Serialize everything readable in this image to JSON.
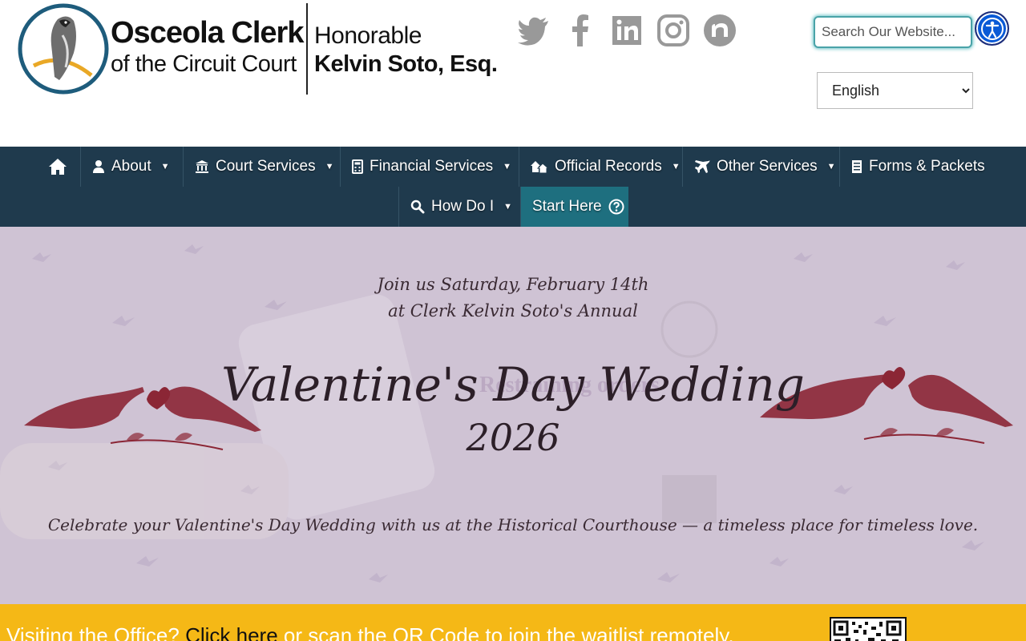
{
  "header": {
    "logo": {
      "title": "Osceola Clerk",
      "subtitle": "of the Circuit Court",
      "honorific": "Honorable",
      "name": "Kelvin Soto, Esq."
    },
    "social": [
      {
        "name": "twitter-icon"
      },
      {
        "name": "facebook-icon"
      },
      {
        "name": "linkedin-icon"
      },
      {
        "name": "instagram-icon"
      },
      {
        "name": "nextdoor-icon"
      }
    ],
    "search": {
      "placeholder": "Search Our Website..."
    },
    "language": {
      "selected": "English"
    },
    "accessibility_icon": "accessibility-icon"
  },
  "nav": {
    "items": [
      {
        "label": "",
        "icon": "home-icon"
      },
      {
        "label": "About",
        "icon": "user-icon",
        "dropdown": true
      },
      {
        "label": "Court Services",
        "icon": "bank-icon",
        "dropdown": true
      },
      {
        "label": "Financial Services",
        "icon": "calculator-icon",
        "dropdown": true
      },
      {
        "label": "Official Records",
        "icon": "houses-icon",
        "dropdown": true
      },
      {
        "label": "Other Services",
        "icon": "plane-icon",
        "dropdown": true
      },
      {
        "label": "Forms & Packets",
        "icon": "document-icon"
      },
      {
        "label": "How Do I",
        "icon": "magnifier-icon",
        "dropdown": true
      },
      {
        "label": "Start Here",
        "icon": "question-icon"
      }
    ]
  },
  "hero": {
    "line1": "Join us Saturday, February 14th",
    "line2": "at Clerk Kelvin Soto's Annual",
    "title": "Valentine's Day Wedding",
    "year": "2026",
    "caption": "Celebrate your Valentine's Day Wedding with us at the Historical Courthouse — a timeless place for timeless love.",
    "colors": {
      "background": "#cfc3d4",
      "accent": "#8b2635"
    }
  },
  "banner": {
    "prefix": "Visiting the Office?",
    "link": "Click here",
    "suffix": "or scan the QR Code to join the waitlist remotely.",
    "colors": {
      "background": "#f5b816"
    }
  },
  "colors": {
    "nav": "#1f3a4d",
    "start_here": "#1e6f7f",
    "social_icon": "#999999"
  }
}
